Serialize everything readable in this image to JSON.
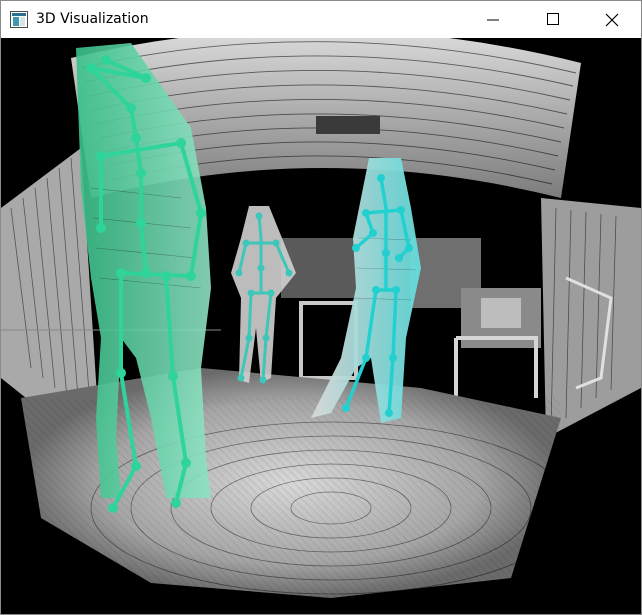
{
  "window": {
    "title": "3D Visualization",
    "app_icon": "app-window-icon",
    "controls": {
      "minimize_icon": "minimize-icon",
      "maximize_icon": "maximize-icon",
      "close_icon": "close-icon"
    }
  },
  "viewport": {
    "content": "point-cloud-3d-view",
    "skeleton_colors": {
      "left_person": "#2fd49a",
      "middle_person": "#3cc7b8",
      "right_person": "#23d0d0"
    },
    "background_color": "#000000",
    "cloud_color": "#bdbdbd"
  }
}
